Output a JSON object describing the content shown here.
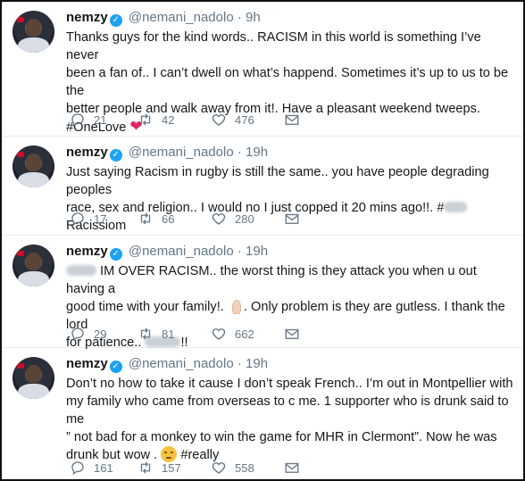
{
  "account": {
    "name": "nemzy",
    "handle": "@nemani_nadolo",
    "dot": "·"
  },
  "icons": {
    "reply": "reply-icon",
    "retweet": "retweet-icon",
    "like": "heart-icon",
    "dm": "envelope-icon",
    "verified": "verified-badge-icon"
  },
  "colors": {
    "verified": "#1da1f2",
    "heart_emoji": "#e0245e",
    "meta": "#657786"
  },
  "tweets": [
    {
      "time": "9h",
      "line1": "Thanks guys for the kind words.. RACISM in this world is something I’ve never",
      "line2": "been a fan of.. I can’t dwell on what’s happend. Sometimes it’s up to us to be the",
      "line3": "better people and walk away from it!. Have a pleasant weekend tweeps.",
      "hashtag": "#OneLove",
      "emoji": "❤",
      "replies": "21",
      "retweets": "42",
      "likes": "476"
    },
    {
      "time": "19h",
      "line1": "Just saying Racism in rugby is still the same.. you have people degrading peoples",
      "line2_a": "race, sex and religion.. I would no I just copped it 20 mins ago!!. #",
      "line2_b": "Racissiom",
      "replies": "17",
      "retweets": "66",
      "likes": "280"
    },
    {
      "time": "19h",
      "line1_b": " IM OVER RACISM.. the worst thing is they attack you when u out having a",
      "line2_a": "good time with your family!. ",
      "line2_b": ". Only problem is they are gutless. I thank the lord",
      "line3_a": "for patience.. ",
      "line3_b": "!!",
      "replies": "29",
      "retweets": "81",
      "likes": "662"
    },
    {
      "time": "19h",
      "line1": "Don’t no how to take it cause I don’t speak French.. I’m out in Montpellier with",
      "line2": "my family who came from overseas to c me. 1 supporter who is drunk said to me",
      "line3": "” not bad for a monkey to win the game for MHR in Clermont”. Now he was",
      "line4_a": "drunk but wow . ",
      "hashtag": "#really",
      "replies": "161",
      "retweets": "157",
      "likes": "558"
    }
  ]
}
